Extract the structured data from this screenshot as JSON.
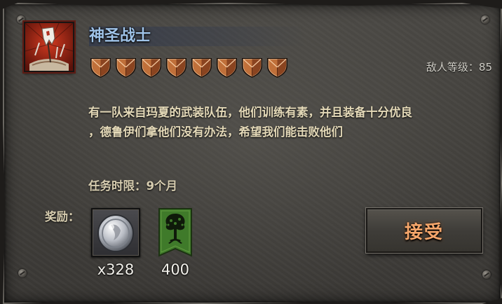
{
  "mission": {
    "title": "神圣战士",
    "difficulty_shields": 8,
    "enemy_level_label": "敌人等级：",
    "enemy_level_value": "85",
    "description_lines": [
      "有一队来自玛夏的武装队伍，他们训练有素，并且装备十分优良",
      "，德鲁伊们拿他们没有办法，希望我们能击败他们"
    ],
    "deadline": "任务时限：9个月",
    "icon": "holy-warrior-banner-icon"
  },
  "rewards": {
    "label": "奖励：",
    "items": [
      {
        "icon": "silver-coin-icon",
        "value": "x328"
      },
      {
        "icon": "tree-banner-icon",
        "value": "400"
      }
    ]
  },
  "actions": {
    "accept_label": "接受"
  },
  "colors": {
    "title": "#9fc3e8",
    "description": "#e4d9b8",
    "shield_copper": "#c0703a",
    "accept_text": "#f4a56a",
    "banner_green": "#3f7a2a"
  }
}
